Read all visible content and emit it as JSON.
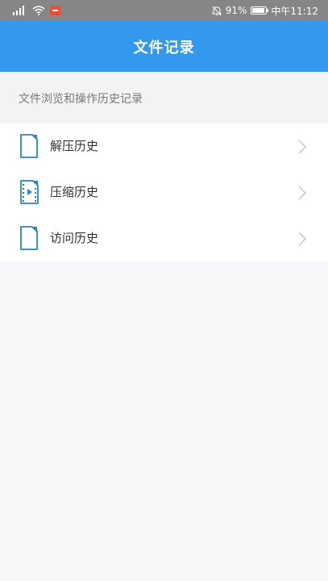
{
  "status_bar": {
    "battery": "91%",
    "time": "中午11:12"
  },
  "app_bar": {
    "title": "文件记录"
  },
  "section": {
    "header": "文件浏览和操作历史记录"
  },
  "list": {
    "items": [
      {
        "label": "解压历史",
        "icon": "document-icon"
      },
      {
        "label": "压缩历史",
        "icon": "video-file-icon"
      },
      {
        "label": "访问历史",
        "icon": "document-icon"
      }
    ]
  },
  "colors": {
    "accent": "#3399ee",
    "status_bar": "#868686",
    "background": "#f7f7f9"
  }
}
